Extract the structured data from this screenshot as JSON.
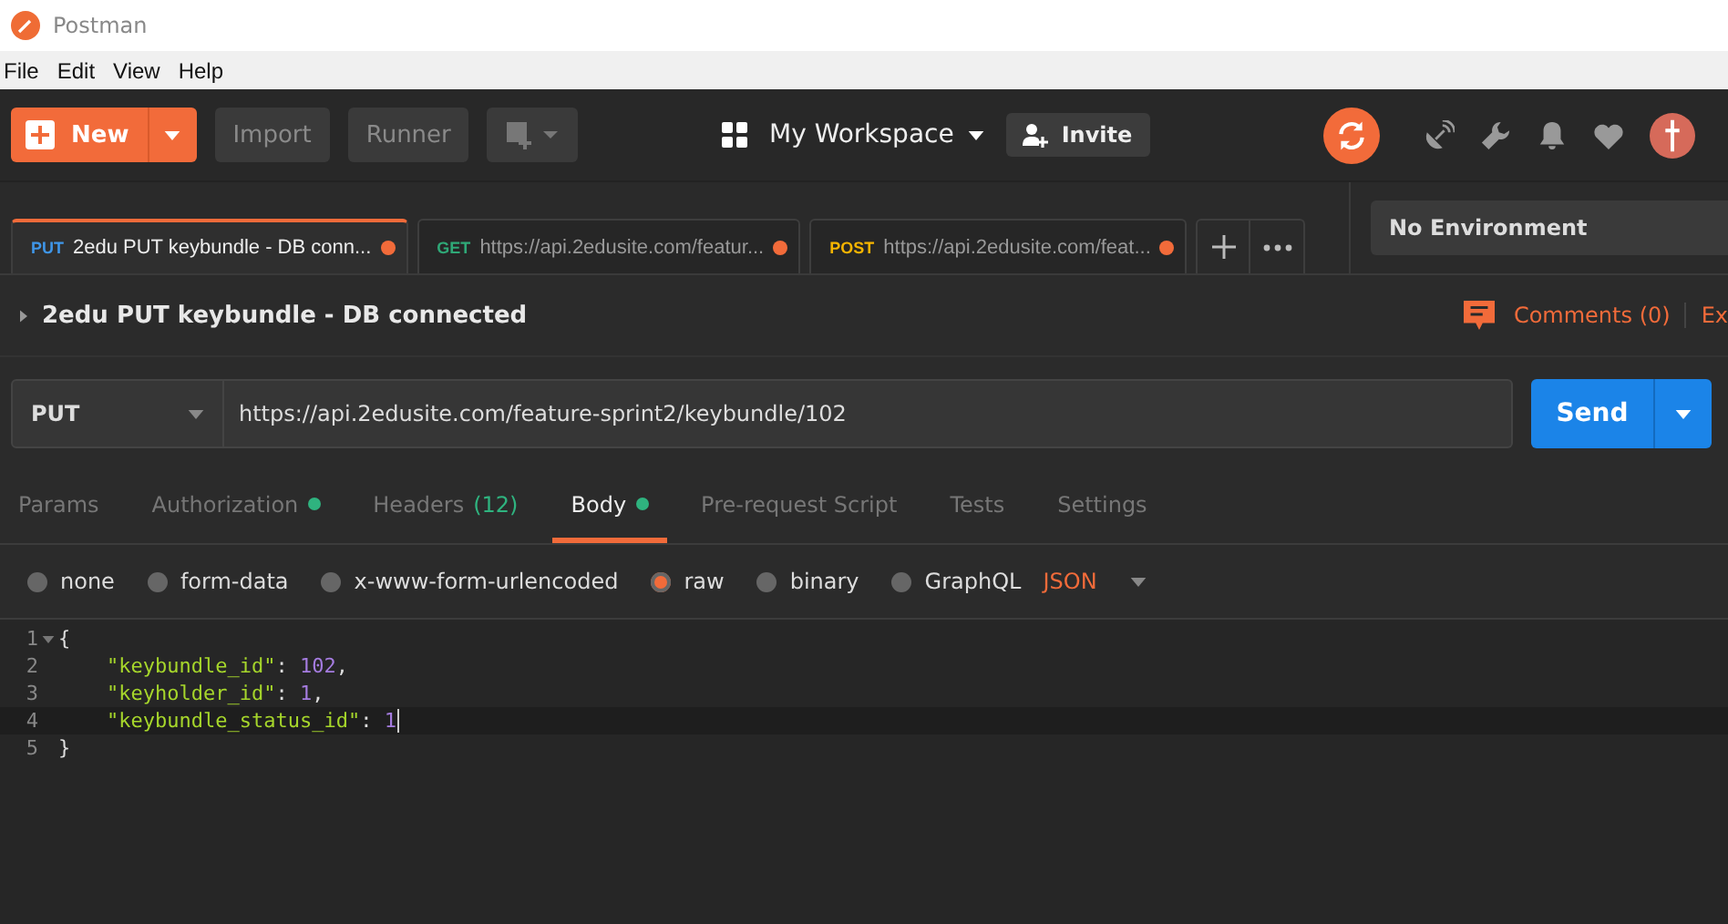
{
  "window": {
    "title": "Postman"
  },
  "menu": [
    "File",
    "Edit",
    "View",
    "Help"
  ],
  "toolbar": {
    "new_label": "New",
    "buttons": [
      "Import",
      "Runner"
    ],
    "workspace": "My Workspace",
    "invite": "Invite"
  },
  "tabs": [
    {
      "method": "PUT",
      "color": "#3f96e8",
      "label": "2edu PUT keybundle - DB conn...",
      "unsaved": true,
      "selected": true
    },
    {
      "method": "GET",
      "color": "#2fa877",
      "label": "https://api.2edusite.com/featur...",
      "unsaved": true,
      "selected": false
    },
    {
      "method": "POST",
      "color": "#f5b400",
      "label": "https://api.2edusite.com/feat...",
      "unsaved": true,
      "selected": false
    }
  ],
  "environment": "No Environment",
  "request": {
    "name": "2edu PUT keybundle - DB connected",
    "comments": "Comments (0)",
    "export": "Ex",
    "method": "PUT",
    "url": "https://api.2edusite.com/feature-sprint2/keybundle/102",
    "send": "Send"
  },
  "subtabs": [
    {
      "label": "Params",
      "dot": false,
      "selected": false
    },
    {
      "label": "Authorization",
      "dot": true,
      "selected": false
    },
    {
      "label": "Headers",
      "count": "(12)",
      "dot": false,
      "selected": false
    },
    {
      "label": "Body",
      "dot": true,
      "selected": true
    },
    {
      "label": "Pre-request Script",
      "dot": false,
      "selected": false
    },
    {
      "label": "Tests",
      "dot": false,
      "selected": false
    },
    {
      "label": "Settings",
      "dot": false,
      "selected": false
    }
  ],
  "body_modes": [
    {
      "label": "none",
      "selected": false
    },
    {
      "label": "form-data",
      "selected": false
    },
    {
      "label": "x-www-form-urlencoded",
      "selected": false
    },
    {
      "label": "raw",
      "selected": true
    },
    {
      "label": "binary",
      "selected": false
    },
    {
      "label": "GraphQL",
      "selected": false
    }
  ],
  "format": "JSON",
  "code_lines": [
    {
      "number": "1",
      "fold": true,
      "active": false,
      "tokens": [
        {
          "kind": "punct",
          "text": "{"
        }
      ]
    },
    {
      "number": "2",
      "fold": false,
      "active": false,
      "tokens": [
        {
          "kind": "key",
          "text": "    \"keybundle_id\""
        },
        {
          "kind": "punct",
          "text": ": "
        },
        {
          "kind": "number",
          "text": "102"
        },
        {
          "kind": "punct",
          "text": ","
        }
      ]
    },
    {
      "number": "3",
      "fold": false,
      "active": false,
      "tokens": [
        {
          "kind": "key",
          "text": "    \"keyholder_id\""
        },
        {
          "kind": "punct",
          "text": ": "
        },
        {
          "kind": "number",
          "text": "1"
        },
        {
          "kind": "punct",
          "text": ","
        }
      ]
    },
    {
      "number": "4",
      "fold": false,
      "active": true,
      "tokens": [
        {
          "kind": "key",
          "text": "    \"keybundle_status_id\""
        },
        {
          "kind": "punct",
          "text": ": "
        },
        {
          "kind": "number",
          "text": "1"
        }
      ]
    },
    {
      "number": "5",
      "fold": false,
      "active": false,
      "tokens": [
        {
          "kind": "punct",
          "text": "}"
        }
      ]
    }
  ]
}
